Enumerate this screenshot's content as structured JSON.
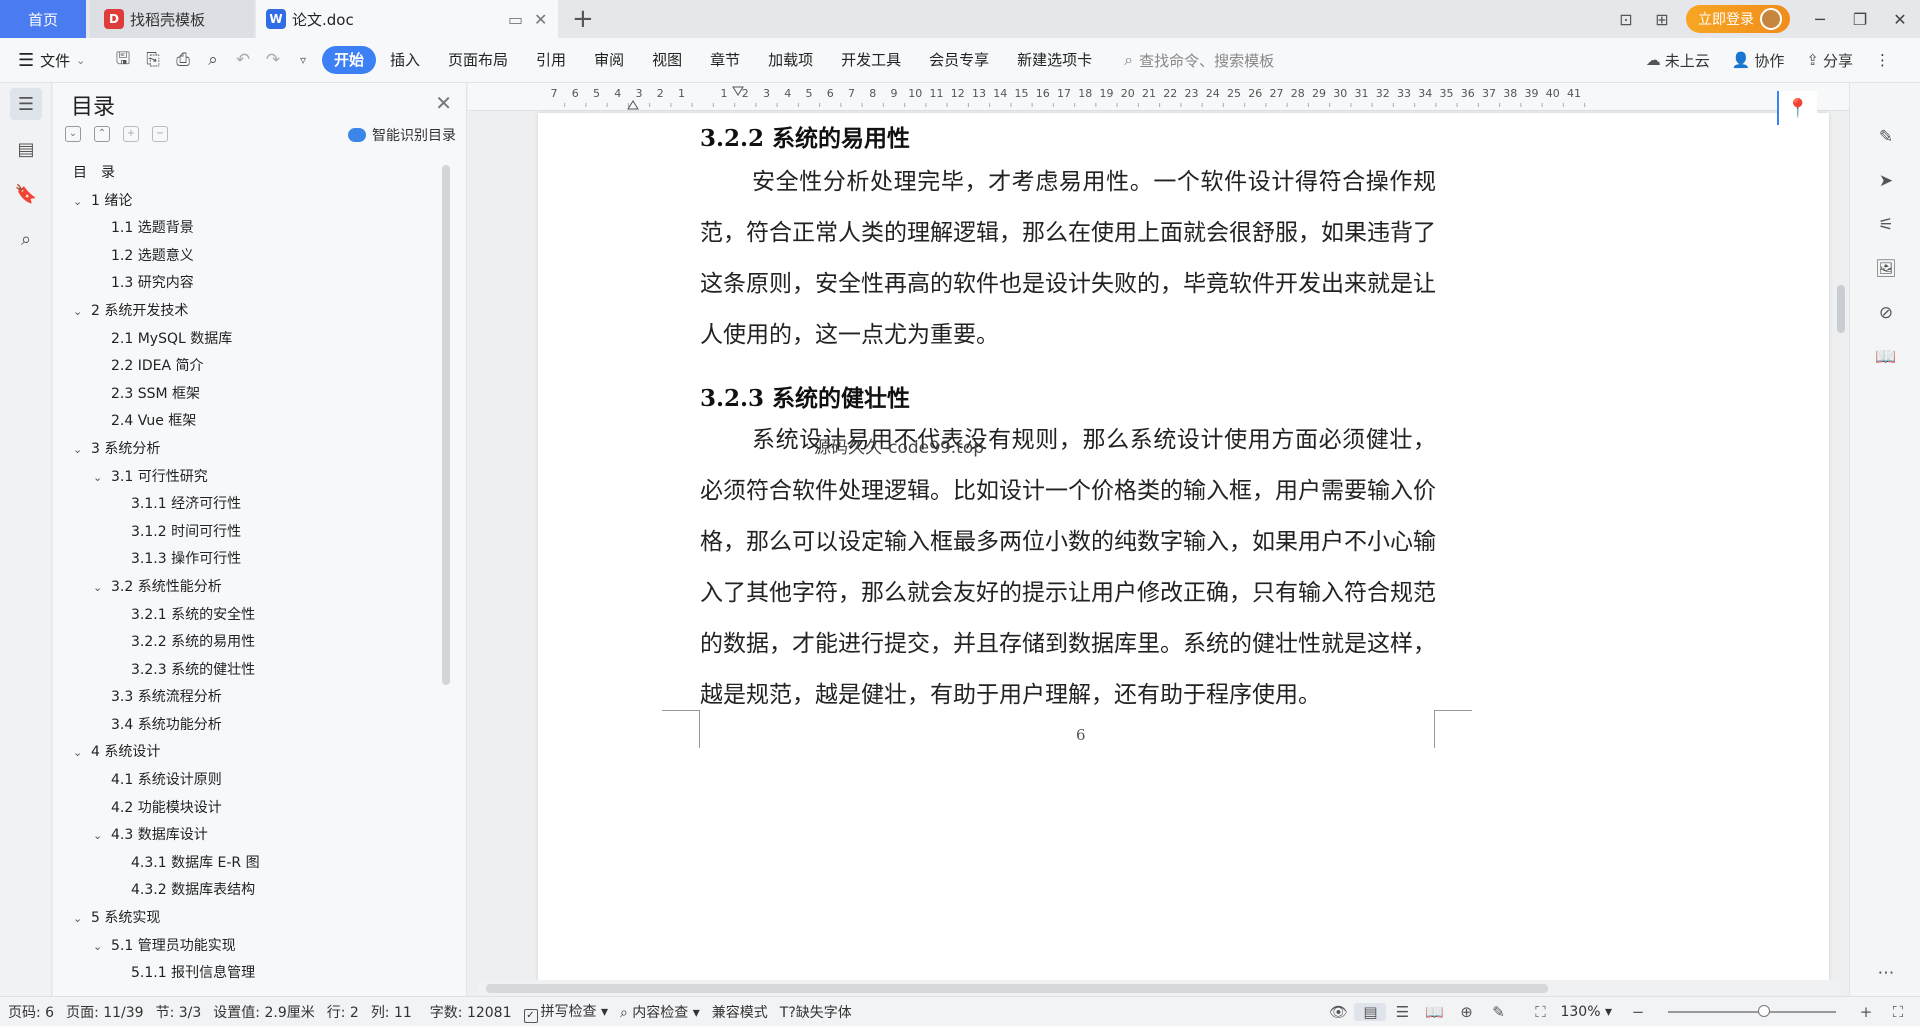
{
  "tabs": {
    "home": "首页",
    "template": "找稻壳模板",
    "doc": "论文.doc"
  },
  "window": {
    "login": "立即登录"
  },
  "ribbon": {
    "file": "文件",
    "menus": [
      "开始",
      "插入",
      "页面布局",
      "引用",
      "审阅",
      "视图",
      "章节",
      "加载项",
      "开发工具",
      "会员专享",
      "新建选项卡"
    ],
    "active_menu": "开始",
    "search_placeholder": "查找命令、搜索模板",
    "cloud": "未上云",
    "collab": "协作",
    "share": "分享"
  },
  "toc": {
    "title": "目录",
    "smart": "智能识别目录",
    "items": [
      {
        "text": "目　录",
        "level": 0,
        "chev": false
      },
      {
        "text": "1  绪论",
        "level": 1,
        "chev": true
      },
      {
        "text": "1.1  选题背景",
        "level": 2,
        "chev": false
      },
      {
        "text": "1.2  选题意义",
        "level": 2,
        "chev": false
      },
      {
        "text": "1.3  研究内容",
        "level": 2,
        "chev": false
      },
      {
        "text": "2  系统开发技术",
        "level": 1,
        "chev": true
      },
      {
        "text": "2.1 MySQL 数据库",
        "level": 2,
        "chev": false
      },
      {
        "text": "2.2 IDEA 简介",
        "level": 2,
        "chev": false
      },
      {
        "text": "2.3 SSM 框架",
        "level": 2,
        "chev": false
      },
      {
        "text": "2.4 Vue 框架",
        "level": 2,
        "chev": false
      },
      {
        "text": "3  系统分析",
        "level": 1,
        "chev": true
      },
      {
        "text": "3.1  可行性研究",
        "level": 2,
        "chev": true
      },
      {
        "text": "3.1.1  经济可行性",
        "level": 3,
        "chev": false
      },
      {
        "text": "3.1.2  时间可行性",
        "level": 3,
        "chev": false
      },
      {
        "text": "3.1.3  操作可行性",
        "level": 3,
        "chev": false
      },
      {
        "text": "3.2  系统性能分析",
        "level": 2,
        "chev": true
      },
      {
        "text": "3.2.1  系统的安全性",
        "level": 3,
        "chev": false
      },
      {
        "text": "3.2.2  系统的易用性",
        "level": 3,
        "chev": false
      },
      {
        "text": "3.2.3  系统的健壮性",
        "level": 3,
        "chev": false
      },
      {
        "text": "3.3  系统流程分析",
        "level": 2,
        "chev": false
      },
      {
        "text": "3.4  系统功能分析",
        "level": 2,
        "chev": false
      },
      {
        "text": "4  系统设计",
        "level": 1,
        "chev": true
      },
      {
        "text": "4.1  系统设计原则",
        "level": 2,
        "chev": false
      },
      {
        "text": "4.2  功能模块设计",
        "level": 2,
        "chev": false
      },
      {
        "text": "4.3  数据库设计",
        "level": 2,
        "chev": true
      },
      {
        "text": "4.3.1  数据库 E-R 图",
        "level": 3,
        "chev": false
      },
      {
        "text": "4.3.2  数据库表结构",
        "level": 3,
        "chev": false
      },
      {
        "text": "5  系统实现",
        "level": 1,
        "chev": true
      },
      {
        "text": "5.1  管理员功能实现",
        "level": 2,
        "chev": true
      },
      {
        "text": "5.1.1  报刊信息管理",
        "level": 3,
        "chev": false
      }
    ]
  },
  "ruler": {
    "labels": [
      "7",
      "6",
      "5",
      "4",
      "3",
      "2",
      "1",
      "",
      "1",
      "2",
      "3",
      "4",
      "5",
      "6",
      "7",
      "8",
      "9",
      "10",
      "11",
      "12",
      "13",
      "14",
      "15",
      "16",
      "17",
      "18",
      "19",
      "20",
      "21",
      "22",
      "23",
      "24",
      "25",
      "26",
      "27",
      "28",
      "29",
      "30",
      "31",
      "32",
      "33",
      "34",
      "35",
      "36",
      "37",
      "38",
      "39",
      "40",
      "41"
    ]
  },
  "document": {
    "h1": "3.2.2  系统的易用性",
    "p1": "安全性分析处理完毕，才考虑易用性。一个软件设计得符合操作规范，符合正常人类的理解逻辑，那么在使用上面就会很舒服，如果违背了这条原则，安全性再高的软件也是设计失败的，毕竟软件开发出来就是让人使用的，这一点尤为重要。",
    "h2": "3.2.3  系统的健壮性",
    "p2": "系统设计易用不代表没有规则，那么系统设计使用方面必须健壮，必须符合软件处理逻辑。比如设计一个价格类的输入框，用户需要输入价格，那么可以设定输入框最多两位小数的纯数字输入，如果用户不小心输入了其他字符，那么就会友好的提示让用户修改正确，只有输入符合规范的数据，才能进行提交，并且存储到数据库里。系统的健壮性就是这样，越是规范，越是健壮，有助于用户理解，还有助于程序使用。",
    "watermark": "源码久久-code99.top",
    "page_number": "6"
  },
  "status": {
    "page": "页码: 6",
    "pages": "页面: 11/39",
    "section": "节: 3/3",
    "setting": "设置值: 2.9厘米",
    "row": "行: 2",
    "col": "列: 11",
    "words": "字数: 12081",
    "spell": "拼写检查",
    "content": "内容检查",
    "compat": "兼容模式",
    "missing_font": "缺失字体",
    "zoom": "130%"
  }
}
